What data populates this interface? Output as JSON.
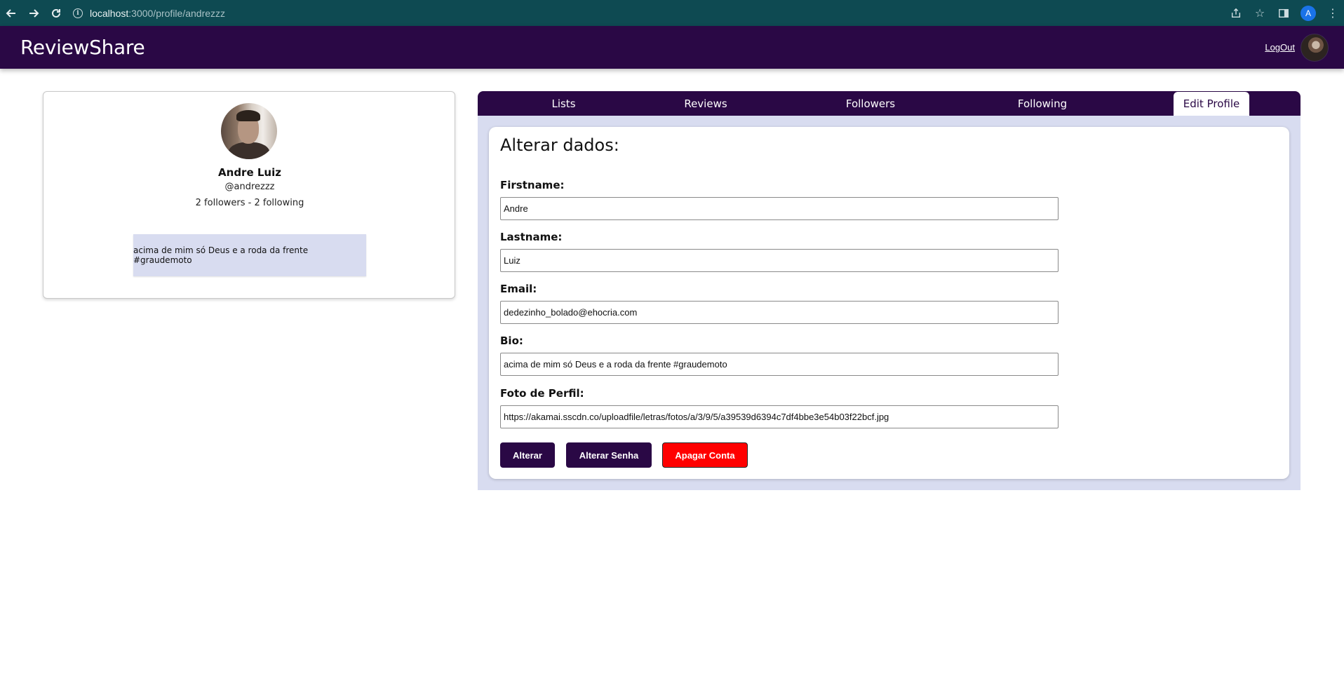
{
  "browser": {
    "url_host": "localhost",
    "url_path": ":3000/profile/andrezzz",
    "profile_initial": "A"
  },
  "header": {
    "brand": "ReviewShare",
    "logout_label": "LogOut"
  },
  "profile": {
    "name": "Andre Luiz",
    "handle": "@andrezzz",
    "stats": "2 followers - 2 following",
    "bio": "acima de mim só Deus e a roda da frente #graudemoto"
  },
  "tabs": [
    {
      "label": "Lists"
    },
    {
      "label": "Reviews"
    },
    {
      "label": "Followers"
    },
    {
      "label": "Following"
    },
    {
      "label": "Edit Profile"
    }
  ],
  "form": {
    "title": "Alterar dados:",
    "fields": [
      {
        "label": "Firstname:",
        "value": "Andre"
      },
      {
        "label": "Lastname:",
        "value": "Luiz"
      },
      {
        "label": "Email:",
        "value": "dedezinho_bolado@ehocria.com"
      },
      {
        "label": "Bio:",
        "value": "acima de mim só Deus e a roda da frente #graudemoto"
      },
      {
        "label": "Foto de Perfil:",
        "value": "https://akamai.sscdn.co/uploadfile/letras/fotos/a/3/9/5/a39539d6394c7df4bbe3e54b03f22bcf.jpg"
      }
    ],
    "buttons": {
      "save": "Alterar",
      "change_password": "Alterar Senha",
      "delete_account": "Apagar Conta"
    }
  },
  "colors": {
    "brand": "#2a0845",
    "panel": "#d8dcf0",
    "danger": "#ff0000",
    "browser": "#0e4a52"
  }
}
